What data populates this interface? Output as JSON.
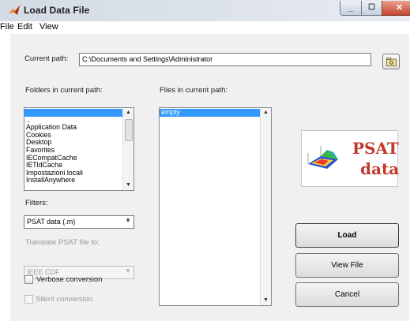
{
  "window": {
    "title": "Load Data File",
    "buttons": {
      "minimize": "minimize",
      "maximize": "maximize",
      "close": "close"
    }
  },
  "menu": {
    "items": [
      "File",
      "Edit",
      "View"
    ]
  },
  "current_path": {
    "label": "Current path:",
    "value": "C:\\Documents and Settings\\Administrator"
  },
  "folders": {
    "label": "Folders in current path:",
    "items": [
      "",
      "..",
      "Application Data",
      "Cookies",
      "Desktop",
      "Favorites",
      "IECompatCache",
      "IETldCache",
      "Impostazioni locali",
      "InstallAnywhere"
    ],
    "selected_index": 0
  },
  "files": {
    "label": "Files in current path:",
    "items": [
      "empty"
    ],
    "selected_index": 0
  },
  "filters": {
    "label": "Filters:",
    "selected": "PSAT data (.m)"
  },
  "translate": {
    "label": "Translate PSAT file to:",
    "selected": "IEEE CDF",
    "enabled": false
  },
  "options": {
    "verbose": {
      "label": "Verbose conversion",
      "checked": false,
      "enabled": true
    },
    "silent": {
      "label": "Silent conversion",
      "checked": false,
      "enabled": false
    }
  },
  "logo": {
    "line1": "PSAT",
    "line2": "data"
  },
  "actions": {
    "load": "Load",
    "view_file": "View File",
    "cancel": "Cancel"
  },
  "icons": {
    "app": "matlab-logo-icon",
    "browse": "folder-browse-icon"
  },
  "colors": {
    "selection": "#3399ff",
    "logo_text": "#c0392b"
  }
}
